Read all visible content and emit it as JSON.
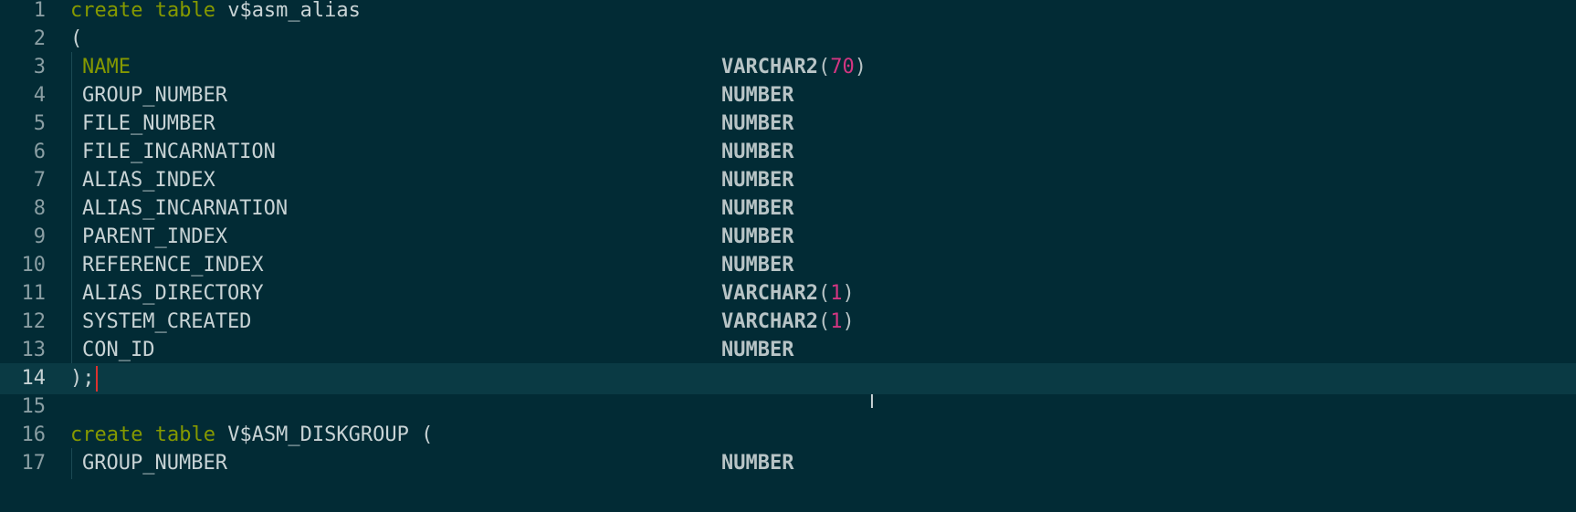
{
  "editor": {
    "current_line": 14,
    "mouse_cursor_glyph": "I",
    "lines": [
      {
        "n": "1",
        "kind": "create",
        "kw": "create table",
        "name": " v$asm_alias"
      },
      {
        "n": "2",
        "kind": "plain",
        "text": "("
      },
      {
        "n": "3",
        "kind": "col",
        "col": "NAME",
        "type": "VARCHAR2",
        "len": "70",
        "hl": true
      },
      {
        "n": "4",
        "kind": "col",
        "col": "GROUP_NUMBER",
        "type": "NUMBER"
      },
      {
        "n": "5",
        "kind": "col",
        "col": "FILE_NUMBER",
        "type": "NUMBER"
      },
      {
        "n": "6",
        "kind": "col",
        "col": "FILE_INCARNATION",
        "type": "NUMBER"
      },
      {
        "n": "7",
        "kind": "col",
        "col": "ALIAS_INDEX",
        "type": "NUMBER"
      },
      {
        "n": "8",
        "kind": "col",
        "col": "ALIAS_INCARNATION",
        "type": "NUMBER"
      },
      {
        "n": "9",
        "kind": "col",
        "col": "PARENT_INDEX",
        "type": "NUMBER"
      },
      {
        "n": "10",
        "kind": "col",
        "col": "REFERENCE_INDEX",
        "type": "NUMBER"
      },
      {
        "n": "11",
        "kind": "col",
        "col": "ALIAS_DIRECTORY",
        "type": "VARCHAR2",
        "len": "1"
      },
      {
        "n": "12",
        "kind": "col",
        "col": "SYSTEM_CREATED",
        "type": "VARCHAR2",
        "len": "1"
      },
      {
        "n": "13",
        "kind": "col",
        "col": "CON_ID",
        "type": "NUMBER"
      },
      {
        "n": "14",
        "kind": "plain",
        "text": ");",
        "cursor": true
      },
      {
        "n": "15",
        "kind": "empty"
      },
      {
        "n": "16",
        "kind": "create",
        "kw": "create table",
        "name": " V$ASM_DISKGROUP ("
      },
      {
        "n": "17",
        "kind": "col",
        "col": "GROUP_NUMBER",
        "type": "NUMBER"
      }
    ]
  }
}
